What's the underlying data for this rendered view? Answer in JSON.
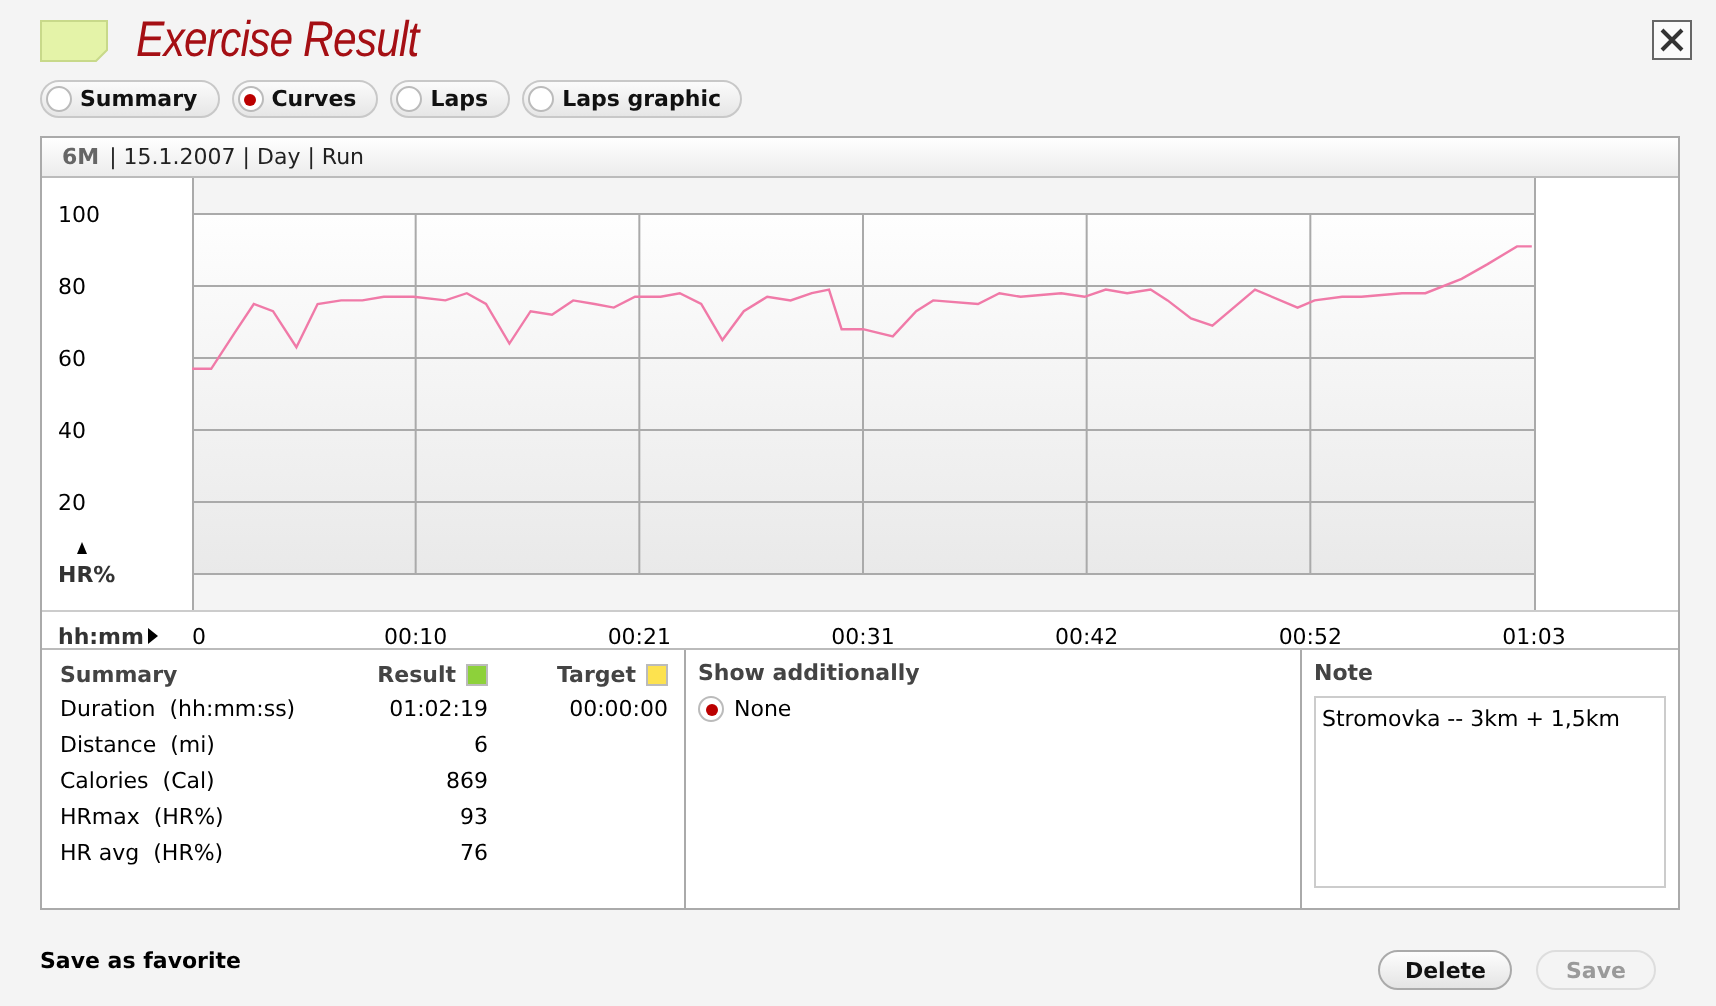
{
  "window": {
    "title": "Exercise Result"
  },
  "tabs": [
    {
      "label": "Summary",
      "selected": false
    },
    {
      "label": "Curves",
      "selected": true
    },
    {
      "label": "Laps",
      "selected": false
    },
    {
      "label": "Laps graphic",
      "selected": false
    }
  ],
  "info_bar": {
    "period": "6M",
    "details": "| 15.1.2007 | Day | Run"
  },
  "chart_data": {
    "type": "line",
    "grid": true,
    "xlabel": "hh:mm",
    "ylabel": "HR%",
    "xlim": [
      0,
      63
    ],
    "ylim": [
      0,
      100
    ],
    "yticks": [
      20,
      40,
      60,
      80,
      100
    ],
    "xticks": [
      {
        "value": 0,
        "label": "0"
      },
      {
        "value": 10.5,
        "label": "00:10"
      },
      {
        "value": 21,
        "label": "00:21"
      },
      {
        "value": 31.5,
        "label": "00:31"
      },
      {
        "value": 42,
        "label": "00:42"
      },
      {
        "value": 52.5,
        "label": "00:52"
      },
      {
        "value": 63,
        "label": "01:03"
      }
    ],
    "x": [
      0,
      0.9,
      2.0,
      2.9,
      3.8,
      4.9,
      5.9,
      7.0,
      8.0,
      9.0,
      10.4,
      11.9,
      12.9,
      13.8,
      14.9,
      15.9,
      16.9,
      17.9,
      18.9,
      19.8,
      20.8,
      22.0,
      22.9,
      23.9,
      24.9,
      25.9,
      27.0,
      28.1,
      29.1,
      29.9,
      30.5,
      31.5,
      32.9,
      34.0,
      34.8,
      36.9,
      37.9,
      38.9,
      40.8,
      41.9,
      42.9,
      43.9,
      45.0,
      45.8,
      46.9,
      47.9,
      49.9,
      51.9,
      52.7,
      54.0,
      54.9,
      56.8,
      57.9,
      59.6,
      60.8,
      62.2,
      62.9
    ],
    "series": [
      {
        "color": "#f07aa8",
        "values": [
          57,
          57,
          67,
          75,
          73,
          63,
          75,
          76,
          76,
          77,
          77,
          76,
          78,
          75,
          64,
          73,
          72,
          76,
          75,
          74,
          77,
          77,
          78,
          75,
          65,
          73,
          77,
          76,
          78,
          79,
          68,
          68,
          66,
          73,
          76,
          75,
          78,
          77,
          78,
          77,
          79,
          78,
          79,
          76,
          71,
          69,
          79,
          74,
          76,
          77,
          77,
          78,
          78,
          82,
          86,
          91,
          91
        ]
      }
    ]
  },
  "summary": {
    "title": "Summary",
    "columns": [
      {
        "label": "Result",
        "color": "#8dd13a"
      },
      {
        "label": "Target",
        "color": "#fde24f"
      }
    ],
    "rows": [
      {
        "label": "Duration  (hh:mm:ss)",
        "result": "01:02:19",
        "target": "00:00:00"
      },
      {
        "label": "Distance  (mi)",
        "result": "6"
      },
      {
        "label": "Calories  (Cal)",
        "result": "869"
      },
      {
        "label": "HRmax  (HR%)",
        "result": "93"
      },
      {
        "label": "HR avg  (HR%)",
        "result": "76"
      }
    ]
  },
  "show_additionally": {
    "title": "Show additionally",
    "options": [
      {
        "label": "None",
        "selected": true
      }
    ]
  },
  "note": {
    "title": "Note",
    "value": "Stromovka -- 3km + 1,5km"
  },
  "footer": {
    "favorite": "Save as favorite",
    "buttons": [
      {
        "label": "Delete",
        "disabled": false
      },
      {
        "label": "Save",
        "disabled": true
      }
    ]
  }
}
